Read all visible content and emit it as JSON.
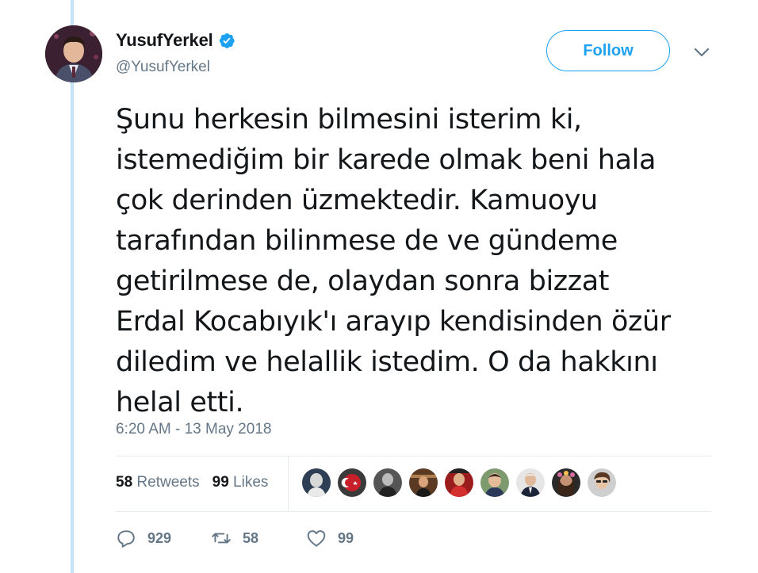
{
  "user": {
    "display_name": "YusufYerkel",
    "handle": "@YusufYerkel",
    "verified": true,
    "avatar_icon": "profile-photo"
  },
  "follow_label": "Follow",
  "tweet": {
    "text": "Şunu herkesin bilmesini isterim ki,\nistemediğim bir karede olmak beni hala\nçok derinden üzmektedir. Kamuoyu\ntarafından bilinmese de ve gündeme\ngetirilmese de, olaydan sonra bizzat\nErdal Kocabıyık'ı arayıp kendisinden özür\ndiledim ve helallik istedim. O da hakkını\nhelal etti.",
    "timestamp": "6:20 AM - 13 May 2018"
  },
  "stats": {
    "retweets_count": "58",
    "retweets_label": "Retweets",
    "likes_count": "99",
    "likes_label": "Likes"
  },
  "likers_count": 9,
  "actions": {
    "reply_count": "929",
    "retweet_count": "58",
    "like_count": "99"
  },
  "colors": {
    "accent": "#1da1f2",
    "thread_line": "#c4e3f7",
    "muted": "#657786",
    "text": "#14171a"
  }
}
